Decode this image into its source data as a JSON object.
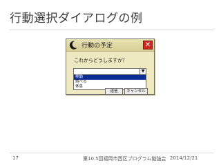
{
  "slide": {
    "title": "行動選択ダイアログの例"
  },
  "dialog": {
    "title": "行動の予定",
    "close_glyph": "✕",
    "icon": "moon-icon",
    "prompt": "これからどうしますか？",
    "combo_value": "",
    "combo_arrow": "▼",
    "options": [
      {
        "label": "移動",
        "selected": true
      },
      {
        "label": "調べる",
        "selected": false
      },
      {
        "label": "休息",
        "selected": false
      }
    ],
    "ok_label": "送信",
    "cancel_label": "キャンセル",
    "colors": {
      "background": "#efe9c1",
      "selection": "#0b2c95",
      "close_button": "#cc2a1e"
    }
  },
  "footer": {
    "page_number": "17",
    "event": "第10.5回福岡市西区プログラム勉強会",
    "date": "2014/12/21"
  }
}
